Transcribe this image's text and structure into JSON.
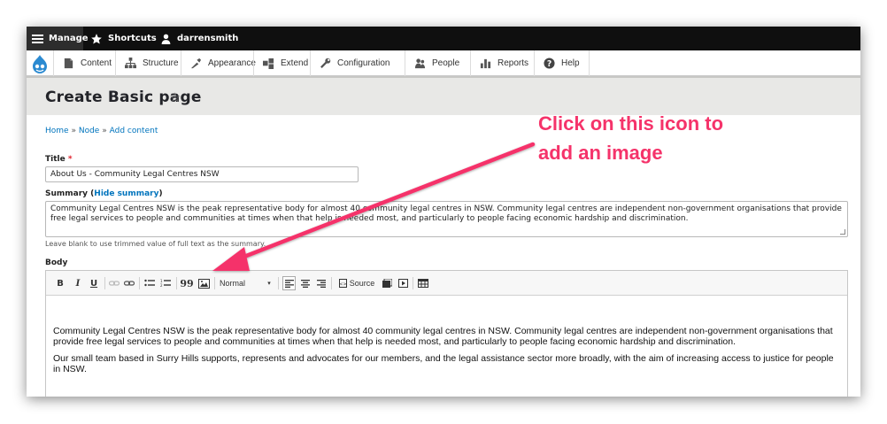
{
  "toolbar": {
    "manage": "Manage",
    "shortcuts": "Shortcuts",
    "user": "darrensmith"
  },
  "admin_menu": {
    "items": [
      {
        "label": "Content",
        "icon": "content-icon"
      },
      {
        "label": "Structure",
        "icon": "structure-icon"
      },
      {
        "label": "Appearance",
        "icon": "appearance-icon"
      },
      {
        "label": "Extend",
        "icon": "extend-icon"
      },
      {
        "label": "Configuration",
        "icon": "configuration-icon"
      },
      {
        "label": "People",
        "icon": "people-icon"
      },
      {
        "label": "Reports",
        "icon": "reports-icon"
      },
      {
        "label": "Help",
        "icon": "help-icon"
      }
    ]
  },
  "page": {
    "title": "Create Basic page",
    "star": "☆"
  },
  "breadcrumb": {
    "items": [
      "Home",
      "Node",
      "Add content"
    ],
    "separator": "»"
  },
  "form": {
    "title_label": "Title",
    "required_marker": "*",
    "title_value": "About Us - Community Legal Centres NSW",
    "summary_label": "Summary",
    "summary_toggle": "Hide summary",
    "summary_value": "Community Legal Centres NSW is the peak representative body for almost 40 community legal centres in NSW. Community legal centres are independent non-government organisations that provide free legal services to people and communities at times when that help is needed most, and particularly to people facing economic hardship and discrimination.",
    "summary_help": "Leave blank to use trimmed value of full text as the summary.",
    "body_label": "Body"
  },
  "editor": {
    "buttons": {
      "bold": "B",
      "italic": "I",
      "underline": "U",
      "blockquote": "99",
      "format": "Normal",
      "source": "Source"
    },
    "paragraphs": [
      "Community Legal Centres NSW is the peak representative body for almost 40 community legal centres in NSW. Community legal centres are independent non-government organisations that provide free legal services to people and communities at times when that help is needed most, and particularly to people facing economic hardship and discrimination.",
      "Our small team based in Surry Hills supports, represents and advocates for our members, and the legal assistance sector more broadly, with the aim of increasing access to justice for people in NSW."
    ]
  },
  "annotation": {
    "line1": "Click on this icon to",
    "line2": "add an image",
    "color": "#f5336a"
  },
  "colors": {
    "link": "#0074bd",
    "toolbar_bg": "#0f0f0f",
    "header_bg": "#e8e8e6",
    "required": "#e0212c"
  }
}
